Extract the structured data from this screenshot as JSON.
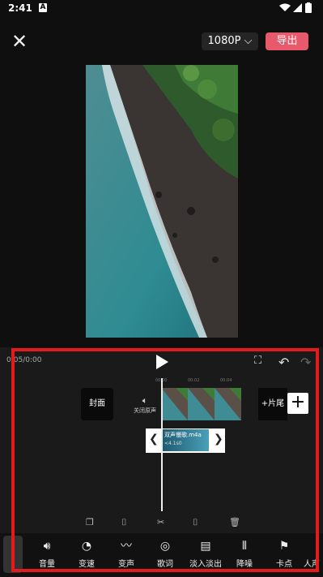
{
  "status": {
    "time": "2:41",
    "notif_icon": "A"
  },
  "header": {
    "close_icon": "close-icon",
    "resolution": "1080P ⌵",
    "export_label": "导出"
  },
  "editor": {
    "timecode": "0:05/0:00",
    "cover_label": "封面",
    "sound_label": "关闭原声",
    "ruler_ticks": [
      "00:00",
      "00:02",
      "00:04"
    ],
    "outro_label": "+片尾",
    "audio": {
      "filename": "双声慢歌.m4a",
      "duration": "<4.1s0"
    }
  },
  "mini_tools": [
    "copy-icon",
    "split-icon",
    "cut-icon",
    "split-right-icon",
    "delete-icon"
  ],
  "tools": [
    {
      "label": "音量",
      "icon": "volume-icon"
    },
    {
      "label": "变速",
      "icon": "speed-icon"
    },
    {
      "label": "变声",
      "icon": "voice-change-icon"
    },
    {
      "label": "歌词",
      "icon": "lyrics-icon"
    },
    {
      "label": "淡入淡出",
      "icon": "fade-icon"
    },
    {
      "label": "降噪",
      "icon": "denoise-icon"
    },
    {
      "label": "卡点",
      "icon": "beat-flag-icon"
    },
    {
      "label": "人声",
      "icon": "vocal-icon"
    }
  ],
  "colors": {
    "accent": "#e85a6b",
    "highlight": "#e31b1b"
  }
}
